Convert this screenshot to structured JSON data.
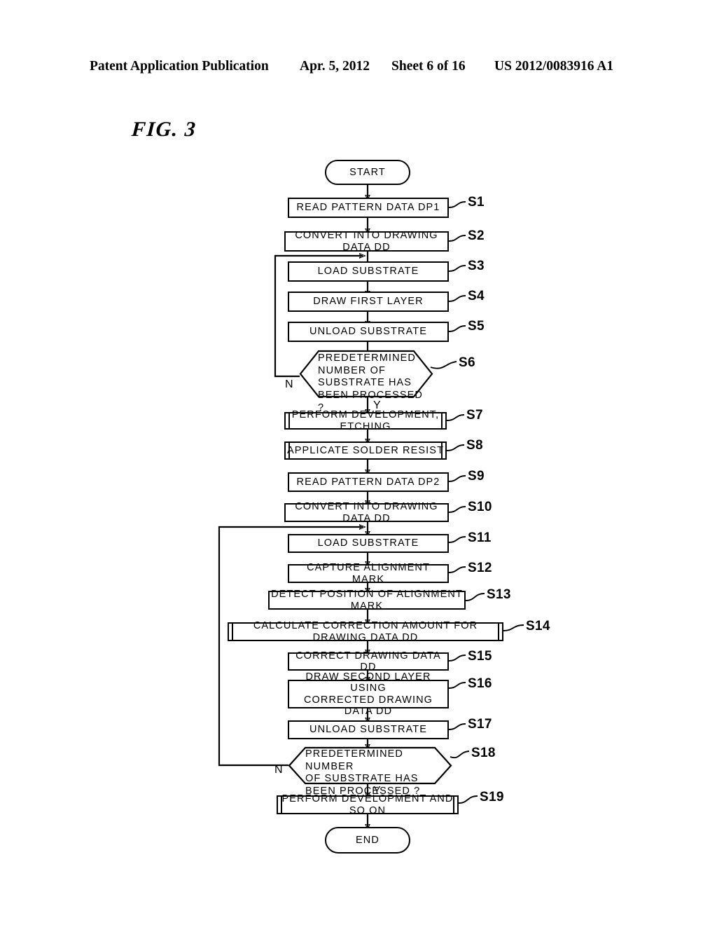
{
  "header": {
    "publication": "Patent Application Publication",
    "date": "Apr. 5, 2012",
    "sheet": "Sheet 6 of 16",
    "number": "US 2012/0083916 A1"
  },
  "figure": {
    "label": "FIG. 3"
  },
  "diagram": {
    "type": "flowchart",
    "start_label": "START",
    "end_label": "END",
    "branch_yes": "Y",
    "branch_no": "N",
    "nodes": [
      {
        "id": "START",
        "step": "",
        "shape": "terminator",
        "text": "START"
      },
      {
        "id": "S1",
        "step": "S1",
        "shape": "process",
        "text": "READ PATTERN DATA DP1"
      },
      {
        "id": "S2",
        "step": "S2",
        "shape": "process",
        "text": "CONVERT INTO DRAWING DATA DD"
      },
      {
        "id": "S3",
        "step": "S3",
        "shape": "process",
        "text": "LOAD SUBSTRATE"
      },
      {
        "id": "S4",
        "step": "S4",
        "shape": "process",
        "text": "DRAW FIRST LAYER"
      },
      {
        "id": "S5",
        "step": "S5",
        "shape": "process",
        "text": "UNLOAD SUBSTRATE"
      },
      {
        "id": "S6",
        "step": "S6",
        "shape": "decision",
        "text": "PREDETERMINED\nNUMBER OF\nSUBSTRATE HAS\nBEEN PROCESSED ?"
      },
      {
        "id": "S7",
        "step": "S7",
        "shape": "predefined",
        "text": "PERFORM DEVELOPMENT, ETCHING"
      },
      {
        "id": "S8",
        "step": "S8",
        "shape": "predefined",
        "text": "APPLICATE SOLDER RESIST"
      },
      {
        "id": "S9",
        "step": "S9",
        "shape": "process",
        "text": "READ PATTERN DATA DP2"
      },
      {
        "id": "S10",
        "step": "S10",
        "shape": "process",
        "text": "CONVERT INTO DRAWING DATA DD"
      },
      {
        "id": "S11",
        "step": "S11",
        "shape": "process",
        "text": "LOAD SUBSTRATE"
      },
      {
        "id": "S12",
        "step": "S12",
        "shape": "process",
        "text": "CAPTURE ALIGNMENT MARK"
      },
      {
        "id": "S13",
        "step": "S13",
        "shape": "process",
        "text": "DETECT POSITION OF ALIGNMENT MARK"
      },
      {
        "id": "S14",
        "step": "S14",
        "shape": "predefined",
        "text": "CALCULATE CORRECTION AMOUNT FOR DRAWING DATA DD"
      },
      {
        "id": "S15",
        "step": "S15",
        "shape": "process",
        "text": "CORRECT DRAWING DATA DD"
      },
      {
        "id": "S16",
        "step": "S16",
        "shape": "process",
        "text": "DRAW SECOND LAYER USING\nCORRECTED DRAWING DATA DD"
      },
      {
        "id": "S17",
        "step": "S17",
        "shape": "process",
        "text": "UNLOAD SUBSTRATE"
      },
      {
        "id": "S18",
        "step": "S18",
        "shape": "decision",
        "text": "PREDETERMINED NUMBER\nOF SUBSTRATE HAS\nBEEN PROCESSED ?"
      },
      {
        "id": "S19",
        "step": "S19",
        "shape": "predefined",
        "text": "PERFORM DEVELOPMENT AND SO ON"
      },
      {
        "id": "END",
        "step": "",
        "shape": "terminator",
        "text": "END"
      }
    ],
    "loops": [
      {
        "from": "S6",
        "to": "S3",
        "label": "N"
      },
      {
        "from": "S18",
        "to": "S11",
        "label": "N"
      }
    ]
  }
}
